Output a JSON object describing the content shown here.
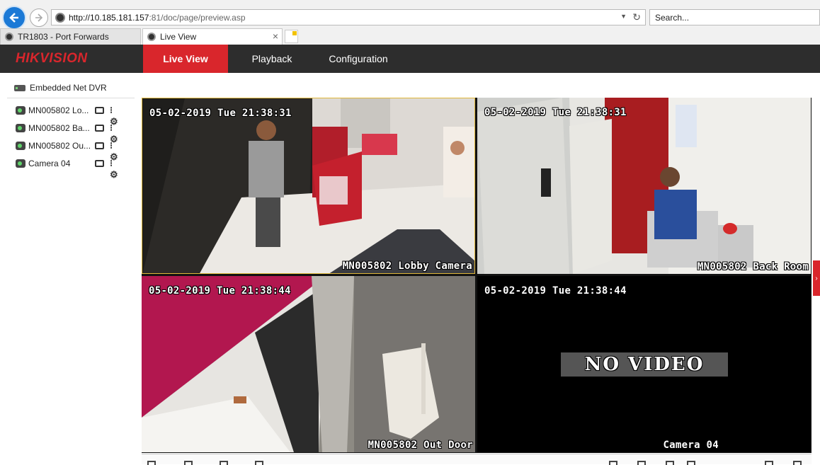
{
  "browser": {
    "address_host": "http://10.185.181.157",
    "address_rest": ":81/doc/page/preview.asp",
    "search_placeholder": "Search...",
    "tabs": [
      {
        "label": "TR1803 - Port Forwards"
      },
      {
        "label": "Live View"
      }
    ]
  },
  "app": {
    "logo": "HIKVISION",
    "menu": [
      {
        "label": "Live View",
        "active": true
      },
      {
        "label": "Playback"
      },
      {
        "label": "Configuration"
      }
    ],
    "accent_color": "#d9262c"
  },
  "sidebar": {
    "device": "Embedded Net DVR",
    "cameras": [
      {
        "label": "MN005802 Lo..."
      },
      {
        "label": "MN005802 Ba..."
      },
      {
        "label": "MN005802 Ou..."
      },
      {
        "label": "Camera 04"
      }
    ]
  },
  "tiles": [
    {
      "timestamp": "05-02-2019 Tue 21:38:31",
      "name": "MN005802 Lobby Camera"
    },
    {
      "timestamp": "05-02-2019 Tue 21:38:31",
      "name": "MN005802 Back Room"
    },
    {
      "timestamp": "05-02-2019 Tue 21:38:44",
      "name": "MN005802 Out Door"
    },
    {
      "timestamp": "05-02-2019 Tue 21:38:44",
      "name": "Camera 04",
      "no_video": "NO VIDEO"
    }
  ]
}
